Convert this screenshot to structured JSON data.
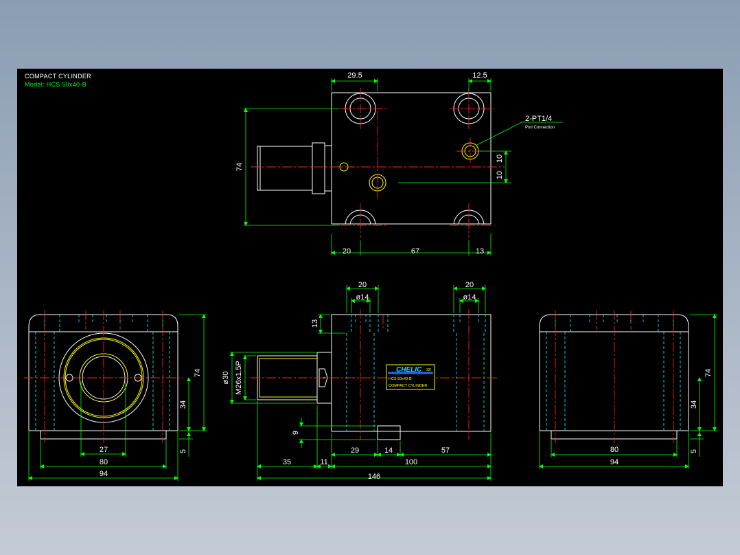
{
  "title": {
    "line1": "COMPACT CYLINDER",
    "line2": "Model: HCS 50x40-B"
  },
  "top_view": {
    "dim_29_5": "29.5",
    "dim_12_5": "12.5",
    "dim_74": "74",
    "dim_10a": "10",
    "dim_10b": "10",
    "dim_20": "20",
    "dim_67": "67",
    "dim_13": "13",
    "port_label": "2-PT1/4",
    "port_sub": "Port Connection"
  },
  "left_view": {
    "dim_74": "74",
    "dim_34": "34",
    "dim_5": "5",
    "dim_27": "27",
    "dim_80": "80",
    "dim_94": "94"
  },
  "front_view": {
    "dim_20a": "20",
    "dim_20b": "20",
    "dia_14a": "ø14",
    "dia_14b": "ø14",
    "dim_13": "13",
    "dia_30": "ø30",
    "thread": "M26x1.5P",
    "dim_9": "9",
    "dim_29": "29",
    "dim_14": "14",
    "dim_57": "57",
    "dim_35": "35",
    "dim_11": "11",
    "dim_100": "100",
    "dim_146": "146",
    "label_brand": "CHELIC",
    "label_code": "33!",
    "label_model": "HCS 50x40-B",
    "label_name": "COMPACT CYLINDER"
  },
  "right_view": {
    "dim_74": "74",
    "dim_34": "34",
    "dim_5": "5",
    "dim_80": "80",
    "dim_94": "94"
  }
}
